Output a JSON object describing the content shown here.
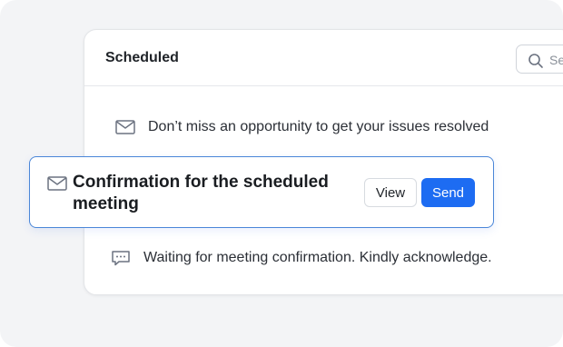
{
  "card": {
    "title": "Scheduled",
    "search_placeholder": "Se"
  },
  "rows": [
    {
      "icon": "mail-icon",
      "text": "Don’t miss an opportunity to get your issues resolved"
    },
    {
      "icon": "chat-icon",
      "text": "Waiting for meeting confirmation. Kindly acknowledge."
    }
  ],
  "popup": {
    "icon": "mail-icon",
    "title": "Confirmation for the scheduled meeting",
    "view_label": "View",
    "send_label": "Send"
  },
  "colors": {
    "accent": "#1d6cf2",
    "popup_border": "#4a86d8",
    "background": "#f3f4f6"
  }
}
